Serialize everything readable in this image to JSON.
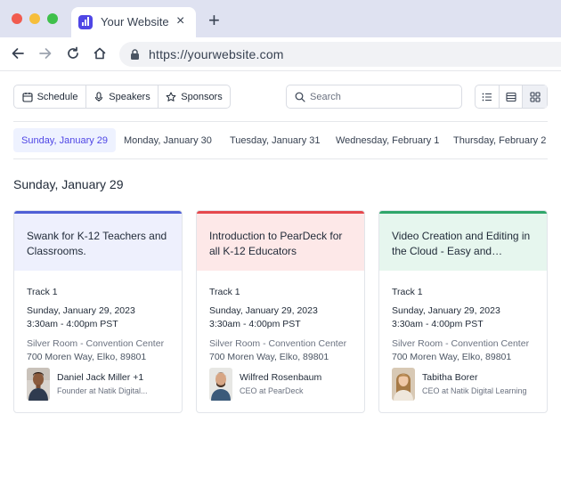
{
  "browser": {
    "tab_title": "Your Website",
    "close_glyph": "×",
    "new_tab_glyph": "+",
    "url": "https://yourwebsite.com"
  },
  "toolbar": {
    "segments": [
      {
        "label": "Schedule",
        "icon": "calendar-icon"
      },
      {
        "label": "Speakers",
        "icon": "microphone-icon"
      },
      {
        "label": "Sponsors",
        "icon": "star-icon"
      }
    ],
    "search_placeholder": "Search",
    "views": [
      "list-view-icon",
      "table-view-icon",
      "grid-view-icon"
    ],
    "active_view": "grid-view-icon"
  },
  "dates": [
    "Sunday, January 29",
    "Monday, January 30",
    "Tuesday, January 31",
    "Wednesday, February 1",
    "Thursday, February 2"
  ],
  "active_date": "Sunday, January 29",
  "day_heading": "Sunday, January 29",
  "sessions": [
    {
      "title": "Swank for K-12 Teachers and Classrooms.",
      "accent": "#4f5fd6",
      "header_bg": "#eef0fd",
      "track": "Track 1",
      "date": "Sunday, January 29, 2023",
      "time": "3:30am - 4:00pm PST",
      "room": "Silver Room - Convention Center",
      "address": "700 Moren Way, Elko, 89801",
      "speaker": "Daniel Jack Miller  +1",
      "role": "Founder at Natik Digital..."
    },
    {
      "title": "Introduction to PearDeck for all K-12 Educators",
      "accent": "#e5484d",
      "header_bg": "#fde8e8",
      "track": "Track 1",
      "date": "Sunday, January 29, 2023",
      "time": "3:30am - 4:00pm PST",
      "room": "Silver Room - Convention Center",
      "address": "700 Moren Way, Elko, 89801",
      "speaker": "Wilfred Rosenbaum",
      "role": "CEO at PearDeck"
    },
    {
      "title": "Video Creation and Editing in the Cloud - Easy and Powerf...",
      "accent": "#2fa66a",
      "header_bg": "#e6f6ee",
      "track": "Track 1",
      "date": "Sunday, January 29, 2023",
      "time": "3:30am - 4:00pm PST",
      "room": "Silver Room - Convention Center",
      "address": "700 Moren Way, Elko, 89801",
      "speaker": "Tabitha Borer",
      "role": "CEO at Natik Digital Learning"
    }
  ]
}
